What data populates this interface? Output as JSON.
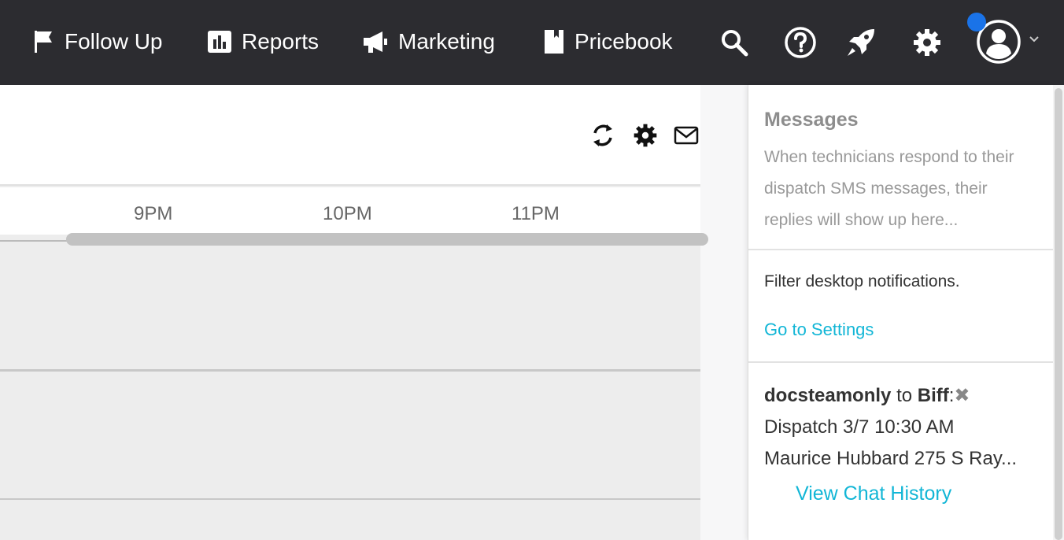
{
  "nav": {
    "items": [
      {
        "label": "Follow Up",
        "icon": "flag-icon"
      },
      {
        "label": "Reports",
        "icon": "bar-chart-icon"
      },
      {
        "label": "Marketing",
        "icon": "megaphone-icon"
      },
      {
        "label": "Pricebook",
        "icon": "book-icon"
      }
    ],
    "icons": [
      "search-icon",
      "help-icon",
      "rocket-icon",
      "gear-icon",
      "user-avatar-icon",
      "chevron-down-icon"
    ],
    "notification_color": "#1a73e8"
  },
  "schedule": {
    "tools": [
      "refresh-icon",
      "settings-icon",
      "mail-icon"
    ],
    "time_labels": [
      "9PM",
      "10PM",
      "11PM"
    ]
  },
  "panel": {
    "messages_title": "Messages",
    "messages_desc": "When technicians respond to their dispatch SMS messages, their replies will show up here...",
    "filter_text": "Filter desktop notifications.",
    "settings_link": "Go to Settings",
    "chat": {
      "from": "docsteamonly",
      "to_word": "to",
      "to": "Biff",
      "separator": ":",
      "close": "✖",
      "line1": "Dispatch 3/7 10:30 AM",
      "line2": "Maurice Hubbard 275 S Ray...",
      "history_link": "View Chat History"
    }
  }
}
